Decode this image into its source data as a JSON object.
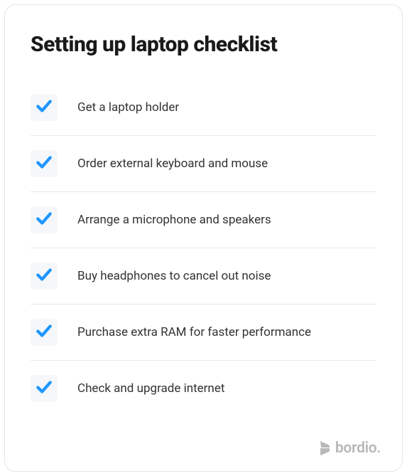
{
  "title": "Setting up laptop checklist",
  "items": [
    {
      "label": "Get a laptop holder",
      "checked": true
    },
    {
      "label": "Order external keyboard and mouse",
      "checked": true
    },
    {
      "label": "Arrange a microphone and speakers",
      "checked": true
    },
    {
      "label": "Buy headphones to cancel out noise",
      "checked": true
    },
    {
      "label": "Purchase extra RAM for faster performance",
      "checked": true
    },
    {
      "label": "Check and upgrade internet",
      "checked": true
    }
  ],
  "brand": "bordio.",
  "colors": {
    "check": "#1e96ff",
    "brand": "#b8b8b8"
  }
}
